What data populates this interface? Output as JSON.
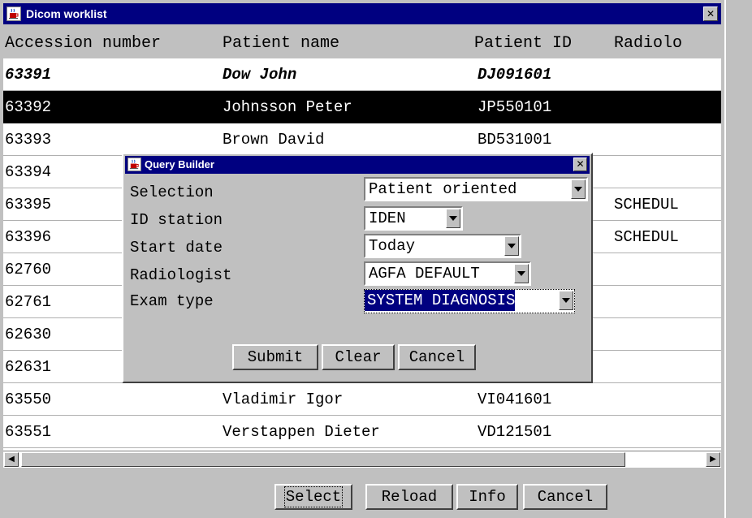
{
  "window": {
    "title": "Dicom worklist",
    "title_icon": "java-cup-icon",
    "close_glyph": "✕"
  },
  "columns": [
    "Accession number",
    "Patient name",
    "Patient ID",
    "Radiolo"
  ],
  "rows": [
    {
      "accession": "63391",
      "patient_name": "Dow John",
      "patient_id": "DJ091601",
      "radiologist": "",
      "style": "bold-italic"
    },
    {
      "accession": "63392",
      "patient_name": "Johnsson Peter",
      "patient_id": "JP550101",
      "radiologist": "",
      "style": "selected"
    },
    {
      "accession": "63393",
      "patient_name": "Brown David",
      "patient_id": "BD531001",
      "radiologist": ""
    },
    {
      "accession": "63394",
      "patient_name": "",
      "patient_id": "",
      "radiologist": ""
    },
    {
      "accession": "63395",
      "patient_name": "",
      "patient_id": "",
      "radiologist": "SCHEDUL"
    },
    {
      "accession": "63396",
      "patient_name": "",
      "patient_id": "",
      "radiologist": "SCHEDUL"
    },
    {
      "accession": "62760",
      "patient_name": "",
      "patient_id": "",
      "radiologist": ""
    },
    {
      "accession": "62761",
      "patient_name": "",
      "patient_id": "",
      "radiologist": ""
    },
    {
      "accession": "62630",
      "patient_name": "",
      "patient_id": "",
      "radiologist": ""
    },
    {
      "accession": "62631",
      "patient_name": "",
      "patient_id": "",
      "radiologist": ""
    },
    {
      "accession": "63550",
      "patient_name": "Vladimir Igor",
      "patient_id": "VI041601",
      "radiologist": ""
    },
    {
      "accession": "63551",
      "patient_name": "Verstappen Dieter",
      "patient_id": "VD121501",
      "radiologist": ""
    }
  ],
  "scrollbar": {
    "left_arrow": "◀",
    "right_arrow": "▶"
  },
  "bottom_buttons": {
    "select": "Select",
    "reload": "Reload",
    "info": "Info",
    "cancel": "Cancel"
  },
  "query_builder": {
    "title": "Query Builder",
    "close_glyph": "✕",
    "fields": {
      "selection": {
        "label": "Selection",
        "value": "Patient oriented"
      },
      "id_station": {
        "label": "ID station",
        "value": "IDEN"
      },
      "start_date": {
        "label": "Start date",
        "value": "Today"
      },
      "radiologist": {
        "label": "Radiologist",
        "value": "AGFA DEFAULT"
      },
      "exam_type": {
        "label": "Exam type",
        "value": "SYSTEM DIAGNOSIS"
      }
    },
    "buttons": {
      "submit": "Submit",
      "clear": "Clear",
      "cancel": "Cancel"
    }
  },
  "colors": {
    "titlebar": "#000080",
    "chrome": "#c0c0c0",
    "selected_row_bg": "#000000",
    "selected_row_fg": "#ffffff"
  }
}
